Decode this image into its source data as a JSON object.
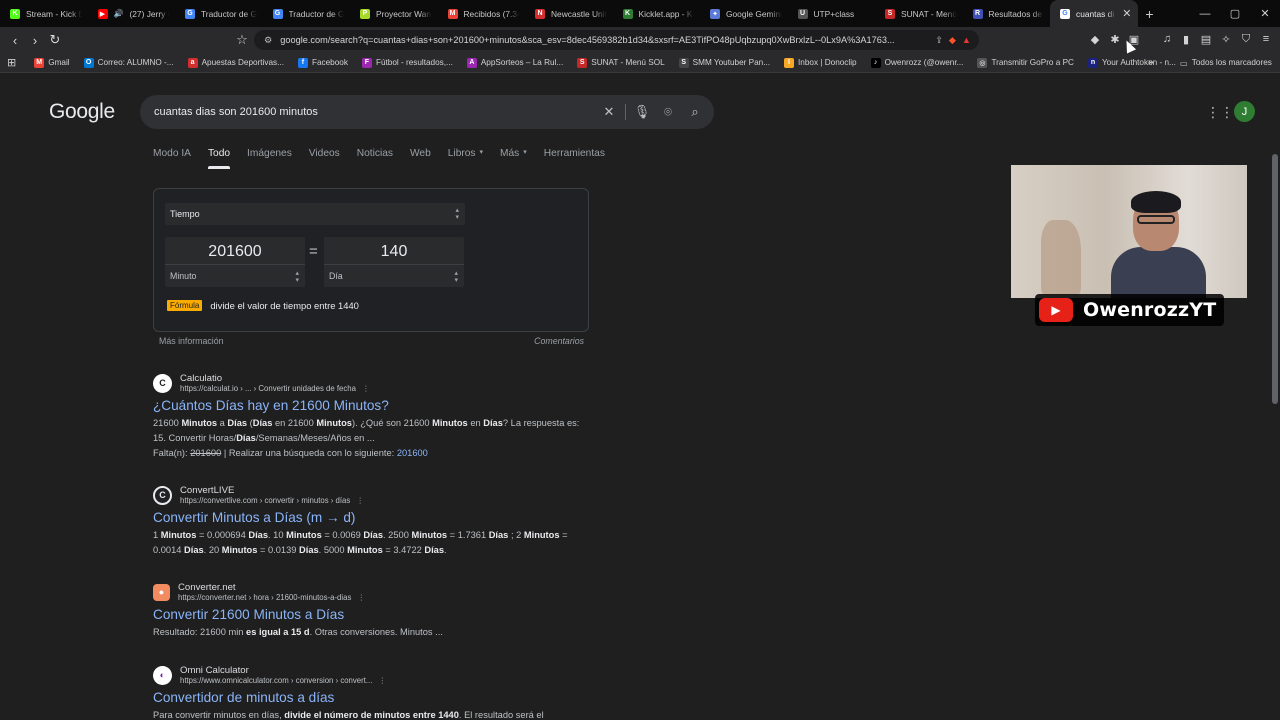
{
  "tabs": [
    {
      "label": "Stream - Kick D",
      "icon": "kick-icon",
      "color": "#53fc18",
      "glyph": "K"
    },
    {
      "label": "(27) Jerry Ri",
      "icon": "youtube-icon",
      "color": "#ff0000",
      "glyph": "▶",
      "audio": "🔊"
    },
    {
      "label": "Traductor de G",
      "icon": "translate-icon",
      "color": "#4285f4",
      "glyph": "G"
    },
    {
      "label": "Traductor de G",
      "icon": "translate-icon",
      "color": "#4285f4",
      "glyph": "G"
    },
    {
      "label": "Proyector Wan",
      "icon": "projector-icon",
      "color": "#a7d92b",
      "glyph": "P"
    },
    {
      "label": "Recibidos (7.34",
      "icon": "gmail-icon",
      "color": "#ea4335",
      "glyph": "M"
    },
    {
      "label": "Newcastle Unit",
      "icon": "newcastle-icon",
      "color": "#d32f2f",
      "glyph": "N"
    },
    {
      "label": "Kicklet.app - K",
      "icon": "kicklet-icon",
      "color": "#2e7d32",
      "glyph": "K"
    },
    {
      "label": "Google Gemini",
      "icon": "gemini-icon",
      "color": "#5b7bd6",
      "glyph": "✦"
    },
    {
      "label": "UTP+class",
      "icon": "utp-icon",
      "color": "#555555",
      "glyph": "U"
    },
    {
      "label": "SUNAT - Menú",
      "icon": "sunat-icon",
      "color": "#c62828",
      "glyph": "S"
    },
    {
      "label": "Resultados de",
      "icon": "results-icon",
      "color": "#3f51b5",
      "glyph": "R"
    },
    {
      "label": "cuantas di",
      "icon": "google-icon",
      "color": "#ffffff",
      "glyph": "G",
      "active": true
    }
  ],
  "tab_close_glyph": "✕",
  "newtab_glyph": "+",
  "window": {
    "minimize": "—",
    "maximize": "▢",
    "close": "✕"
  },
  "nav": {
    "back": "‹",
    "forward": "›",
    "reload": "↻",
    "bookmark": "☆",
    "site_info": "⚙"
  },
  "omnibox": {
    "url": "google.com/search?q=cuantas+dias+son+201600+minutos&sca_esv=8dec4569382b1d34&sxsrf=AE3TifPO48pUqbzupq0XwBrxlzL--0Lx9A%3A1763..."
  },
  "bookmarks": [
    {
      "label": "Gmail",
      "color": "#ea4335",
      "glyph": "M"
    },
    {
      "label": "Correo: ALUMNO -...",
      "color": "#0078d4",
      "glyph": "O"
    },
    {
      "label": "Apuestas Deportivas...",
      "color": "#d32f2f",
      "glyph": "a"
    },
    {
      "label": "Facebook",
      "color": "#1877f2",
      "glyph": "f"
    },
    {
      "label": "Fútbol - resultados,...",
      "color": "#9c27b0",
      "glyph": "F"
    },
    {
      "label": "AppSorteos – La Rul...",
      "color": "#9c27b0",
      "glyph": "A"
    },
    {
      "label": "SUNAT - Menú SOL",
      "color": "#c62828",
      "glyph": "S"
    },
    {
      "label": "SMM Youtuber Pan...",
      "color": "#444444",
      "glyph": "S"
    },
    {
      "label": "Inbox | Donoclip",
      "color": "#f9a825",
      "glyph": "I"
    },
    {
      "label": "Owenrozz (@owenr...",
      "color": "#000000",
      "glyph": "♪"
    },
    {
      "label": "Transmitir GoPro a PC",
      "color": "#555555",
      "glyph": "◎"
    },
    {
      "label": "Your Authtoken - n...",
      "color": "#1a237e",
      "glyph": "n"
    }
  ],
  "bookmarks_more": "»",
  "all_bookmarks": "Todos los marcadores",
  "google": {
    "logo": "Google",
    "query": "cuantas dias son 201600 minutos",
    "avatar_letter": "J",
    "tabs": [
      "Modo IA",
      "Todo",
      "Imágenes",
      "Videos",
      "Noticias",
      "Web",
      "Libros",
      "Más",
      "Herramientas"
    ],
    "active_tab": "Todo"
  },
  "converter": {
    "category": "Tiempo",
    "from_value": "201600",
    "from_unit": "Minuto",
    "equals": "=",
    "to_value": "140",
    "to_unit": "Día",
    "formula_badge": "Fórmula",
    "formula_text": "divide el valor de tiempo entre 1440",
    "more_info": "Más información",
    "feedback": "Comentarios"
  },
  "results": [
    {
      "site": "Calculatio",
      "url": "https://calculat.io › ... › Convertir unidades de fecha",
      "title": "¿Cuántos Días hay en 21600 Minutos?",
      "fav": "C",
      "snippet_html": "21600 <b>Minutos</b> a <b>Días</b> (<b>Días</b> en 21600 <b>Minutos</b>). ¿Qué son 21600 <b>Minutos</b> en <b>Días</b>? La respuesta es: 15. Convertir Horas/<b>Días</b>/Semanas/Meses/Años en ...",
      "missing_label": "Falta(n):",
      "missing_term": "201600",
      "search_with": "| Realizar una búsqueda con lo siguiente:",
      "search_term": "201600"
    },
    {
      "site": "ConvertLIVE",
      "url": "https://convertlive.com › convertir › minutos › días",
      "title": "Convertir Minutos a Días (m → d)",
      "fav": "C",
      "snippet_html": "1 <b>Minutos</b> = 0.000694 <b>Días</b>. 10 <b>Minutos</b> = 0.0069 <b>Días</b>. 2500 <b>Minutos</b> = 1.7361 <b>Días</b> ; 2 <b>Minutos</b> = 0.0014 <b>Días</b>. 20 <b>Minutos</b> = 0.0139 <b>Días</b>. 5000 <b>Minutos</b> = 3.4722 <b>Días</b>."
    },
    {
      "site": "Converter.net",
      "url": "https://converter.net › hora › 21600-minutos-a-dias",
      "title": "Convertir 21600 Minutos a Días",
      "fav": "●",
      "snippet_html": "Resultado: 21600 min <b>es igual a 15 d</b>. Otras conversiones. Minutos ..."
    },
    {
      "site": "Omni Calculator",
      "url": "https://www.omnicalculator.com › conversion › convert...",
      "title": "Convertidor de minutos a días",
      "fav": "◐",
      "snippet_html": "Para convertir minutos en días, <b>divide el número de minutos entre 1440</b>. El resultado será el"
    }
  ],
  "overlay": {
    "channel": "OwenrozzYT",
    "play": "▶"
  }
}
